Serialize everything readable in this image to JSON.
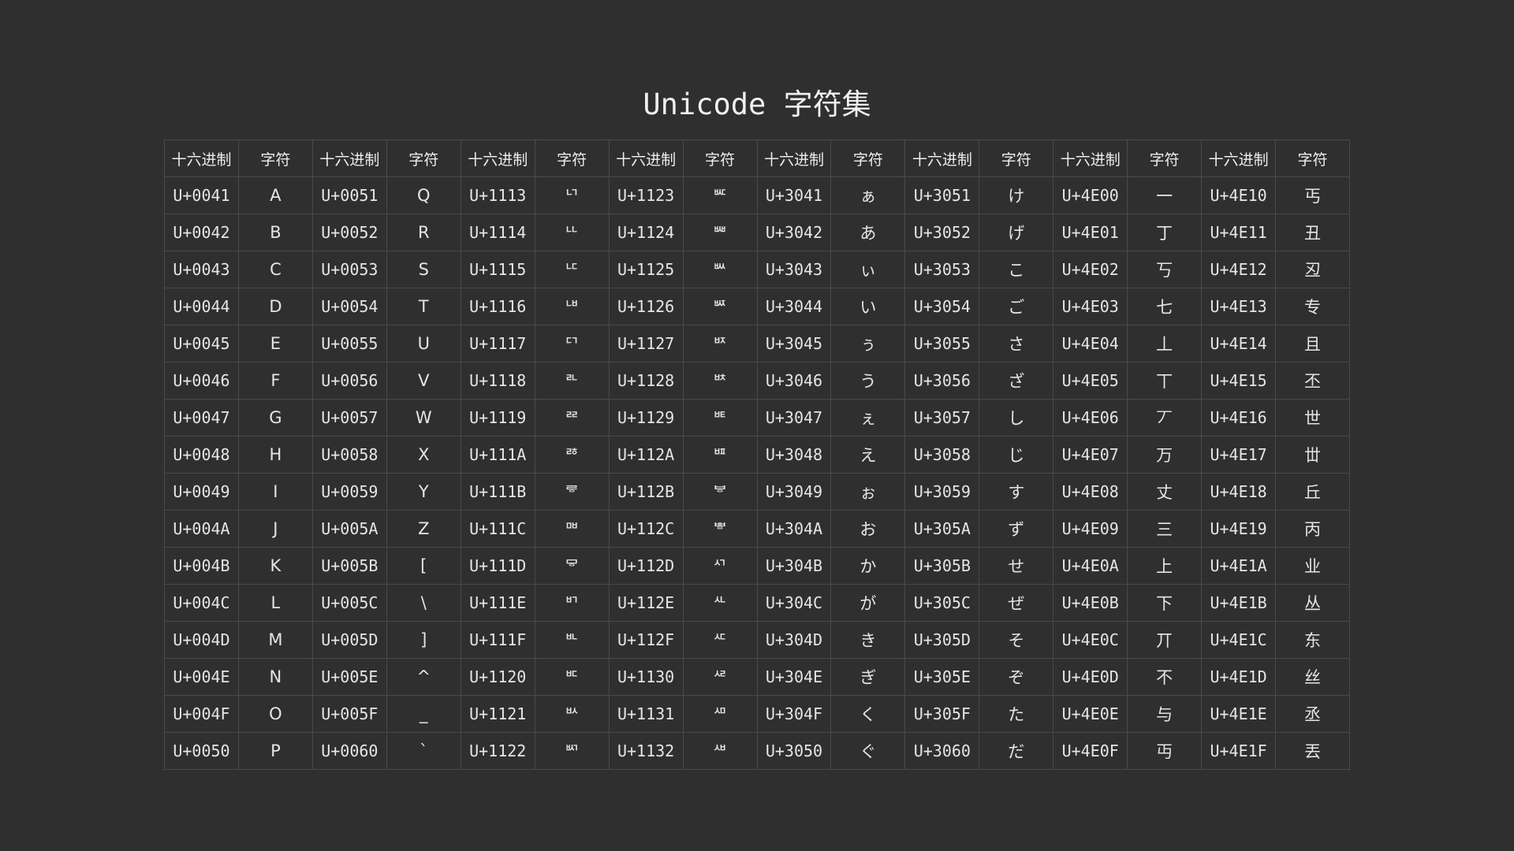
{
  "title": "Unicode 字符集",
  "headers": [
    "十六进制",
    "字符",
    "十六进制",
    "字符",
    "十六进制",
    "字符",
    "十六进制",
    "字符",
    "十六进制",
    "字符",
    "十六进制",
    "字符",
    "十六进制",
    "字符",
    "十六进制",
    "字符"
  ],
  "rows": [
    [
      "U+0041",
      "A",
      "U+0051",
      "Q",
      "U+1113",
      "ᄓ",
      "U+1123",
      "ᄣ",
      "U+3041",
      "ぁ",
      "U+3051",
      "け",
      "U+4E00",
      "一",
      "U+4E10",
      "丐"
    ],
    [
      "U+0042",
      "B",
      "U+0052",
      "R",
      "U+1114",
      "ᄔ",
      "U+1124",
      "ᄤ",
      "U+3042",
      "あ",
      "U+3052",
      "げ",
      "U+4E01",
      "丁",
      "U+4E11",
      "丑"
    ],
    [
      "U+0043",
      "C",
      "U+0053",
      "S",
      "U+1115",
      "ᄕ",
      "U+1125",
      "ᄥ",
      "U+3043",
      "ぃ",
      "U+3053",
      "こ",
      "U+4E02",
      "丂",
      "U+4E12",
      "丒"
    ],
    [
      "U+0044",
      "D",
      "U+0054",
      "T",
      "U+1116",
      "ᄖ",
      "U+1126",
      "ᄦ",
      "U+3044",
      "い",
      "U+3054",
      "ご",
      "U+4E03",
      "七",
      "U+4E13",
      "专"
    ],
    [
      "U+0045",
      "E",
      "U+0055",
      "U",
      "U+1117",
      "ᄗ",
      "U+1127",
      "ᄧ",
      "U+3045",
      "ぅ",
      "U+3055",
      "さ",
      "U+4E04",
      "丄",
      "U+4E14",
      "且"
    ],
    [
      "U+0046",
      "F",
      "U+0056",
      "V",
      "U+1118",
      "ᄘ",
      "U+1128",
      "ᄨ",
      "U+3046",
      "う",
      "U+3056",
      "ざ",
      "U+4E05",
      "丅",
      "U+4E15",
      "丕"
    ],
    [
      "U+0047",
      "G",
      "U+0057",
      "W",
      "U+1119",
      "ᄙ",
      "U+1129",
      "ᄩ",
      "U+3047",
      "ぇ",
      "U+3057",
      "し",
      "U+4E06",
      "丆",
      "U+4E16",
      "世"
    ],
    [
      "U+0048",
      "H",
      "U+0058",
      "X",
      "U+111A",
      "ᄚ",
      "U+112A",
      "ᄪ",
      "U+3048",
      "え",
      "U+3058",
      "じ",
      "U+4E07",
      "万",
      "U+4E17",
      "丗"
    ],
    [
      "U+0049",
      "I",
      "U+0059",
      "Y",
      "U+111B",
      "ᄛ",
      "U+112B",
      "ᄫ",
      "U+3049",
      "ぉ",
      "U+3059",
      "す",
      "U+4E08",
      "丈",
      "U+4E18",
      "丘"
    ],
    [
      "U+004A",
      "J",
      "U+005A",
      "Z",
      "U+111C",
      "ᄜ",
      "U+112C",
      "ᄬ",
      "U+304A",
      "お",
      "U+305A",
      "ず",
      "U+4E09",
      "三",
      "U+4E19",
      "丙"
    ],
    [
      "U+004B",
      "K",
      "U+005B",
      "[",
      "U+111D",
      "ᄝ",
      "U+112D",
      "ᄭ",
      "U+304B",
      "か",
      "U+305B",
      "せ",
      "U+4E0A",
      "上",
      "U+4E1A",
      "业"
    ],
    [
      "U+004C",
      "L",
      "U+005C",
      "\\",
      "U+111E",
      "ᄞ",
      "U+112E",
      "ᄮ",
      "U+304C",
      "が",
      "U+305C",
      "ぜ",
      "U+4E0B",
      "下",
      "U+4E1B",
      "丛"
    ],
    [
      "U+004D",
      "M",
      "U+005D",
      "]",
      "U+111F",
      "ᄟ",
      "U+112F",
      "ᄯ",
      "U+304D",
      "き",
      "U+305D",
      "そ",
      "U+4E0C",
      "丌",
      "U+4E1C",
      "东"
    ],
    [
      "U+004E",
      "N",
      "U+005E",
      "^",
      "U+1120",
      "ᄠ",
      "U+1130",
      "ᄰ",
      "U+304E",
      "ぎ",
      "U+305E",
      "ぞ",
      "U+4E0D",
      "不",
      "U+4E1D",
      "丝"
    ],
    [
      "U+004F",
      "O",
      "U+005F",
      "_",
      "U+1121",
      "ᄡ",
      "U+1131",
      "ᄱ",
      "U+304F",
      "く",
      "U+305F",
      "た",
      "U+4E0E",
      "与",
      "U+4E1E",
      "丞"
    ],
    [
      "U+0050",
      "P",
      "U+0060",
      "`",
      "U+1122",
      "ᄢ",
      "U+1132",
      "ᄲ",
      "U+3050",
      "ぐ",
      "U+3060",
      "だ",
      "U+4E0F",
      "丏",
      "U+4E1F",
      "丟"
    ]
  ]
}
